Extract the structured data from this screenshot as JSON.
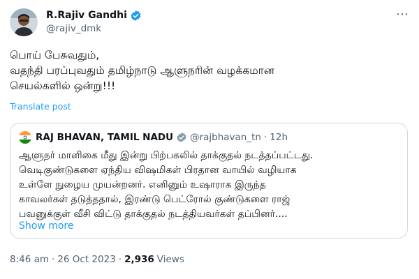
{
  "author": {
    "name": "R.Rajiv Gandhi",
    "handle": "@rajiv_dmk"
  },
  "tweet": {
    "text": "பொய் பேசுவதும்,\nவதந்தி பரப்புவதும் தமிழ்நாடு ஆளுநரின் வழக்கமான\nசெயல்களில் ஒன்று!!!",
    "translate_label": "Translate post"
  },
  "quote": {
    "name": "RAJ BHAVAN, TAMIL NADU",
    "handle": "@rajbhavan_tn",
    "dot": "·",
    "time": "12h",
    "text": "ஆளுநர் மாளிகை மீது இன்று பிற்பகலில் தாக்குதல் நடத்தப்பட்டது.\nவெடிகுண்டுகளை ஏந்திய விஷமிகள் பிரதான வாயில் வழியாக\nஉள்ளே நுழைய முயன்றனர். எனினும் உஷாராக இருந்த\nகாவலர்கள் தடுத்ததால், இரண்டு பெட்ரோல் குண்டுகளை ராஜ்\nபவனுக்குள் வீசி விட்டு தாக்குதல்  நடத்தியவர்கள் தப்பினர்....",
    "show_more": "Show more"
  },
  "meta": {
    "time": "8:46 am",
    "sep1": "·",
    "date": "26 Oct 2023",
    "sep2": "·",
    "views_count": "2,936",
    "views_label": "Views"
  },
  "icons": {
    "more": "⋯",
    "verified_color": "#1d9bf0",
    "flag_colors": [
      "#ff9933",
      "#ffffff",
      "#138808"
    ]
  }
}
